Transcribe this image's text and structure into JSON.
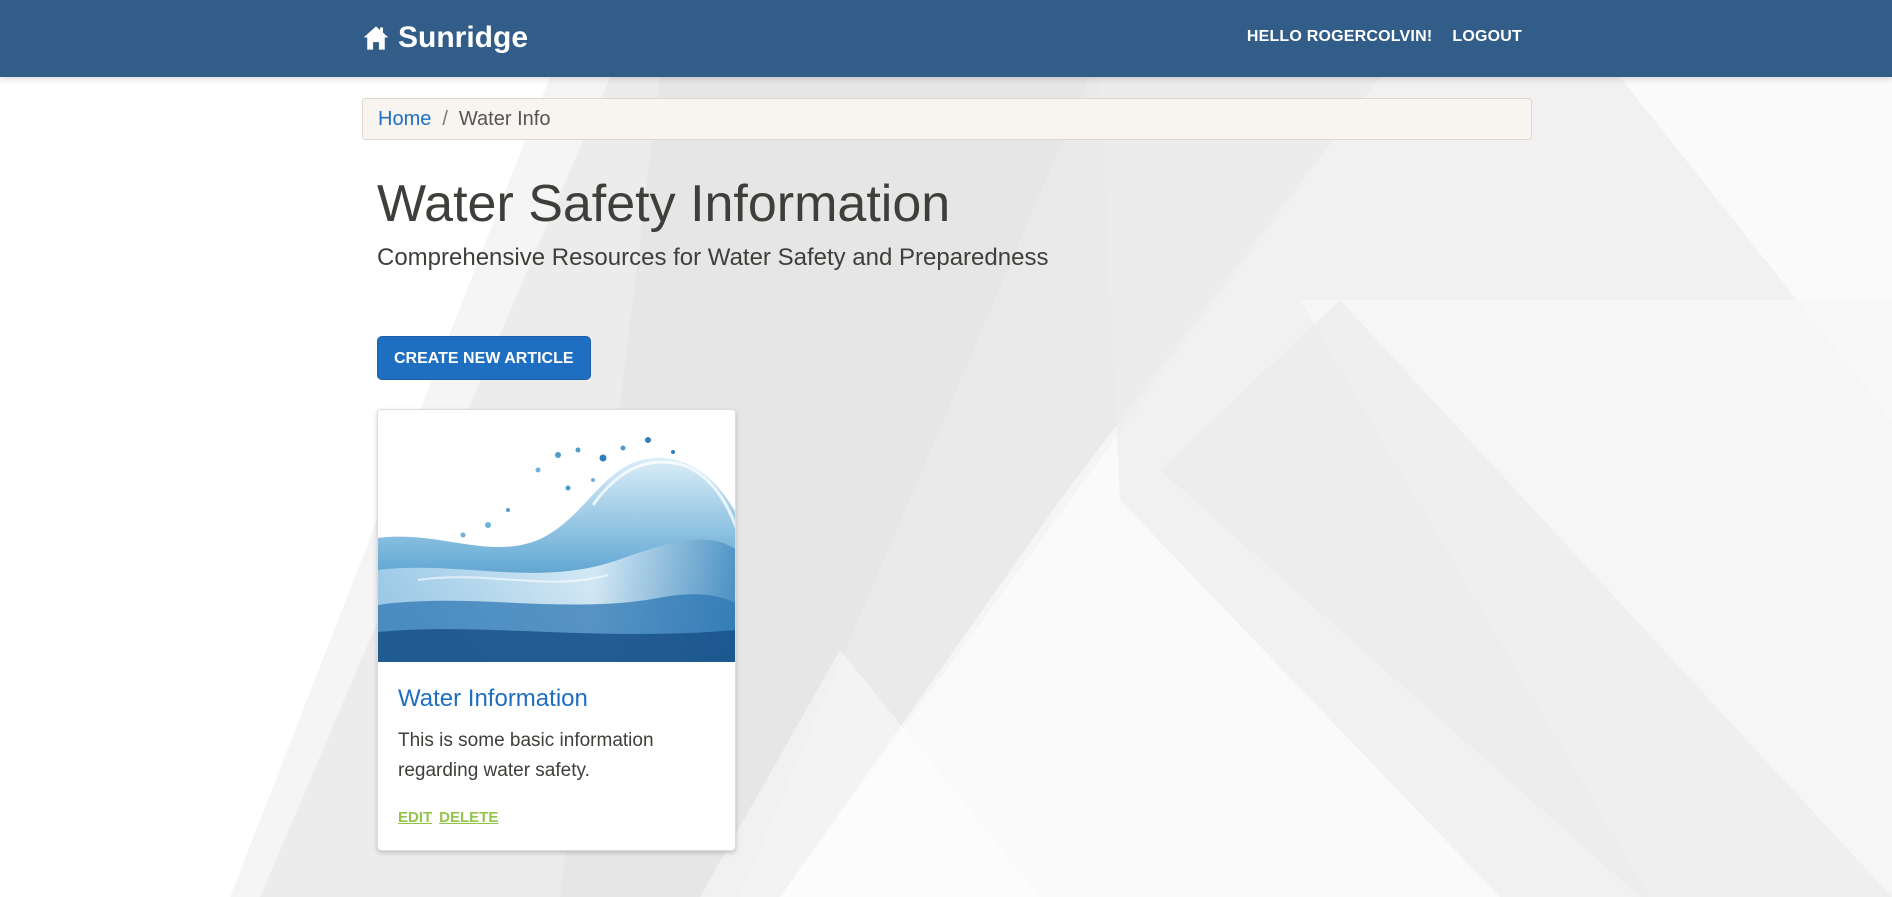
{
  "navbar": {
    "brand": "Sunridge",
    "brand_icon": "home-icon",
    "greeting": "HELLO ROGERCOLVIN!",
    "logout_label": "LOGOUT",
    "background_color": "#325d88"
  },
  "breadcrumb": {
    "home_label": "Home",
    "separator": "/",
    "current_label": "Water Info"
  },
  "page": {
    "title": "Water Safety Information",
    "subtitle": "Comprehensive Resources for Water Safety and Preparedness",
    "create_button_label": "CREATE NEW ARTICLE"
  },
  "articles": [
    {
      "title": "Water Information",
      "summary": "This is some basic information regarding water safety.",
      "image_alt": "water splash",
      "edit_label": "EDIT",
      "delete_label": "DELETE"
    }
  ],
  "colors": {
    "accent": "#1e6ec2",
    "action_link": "#93c54b"
  }
}
